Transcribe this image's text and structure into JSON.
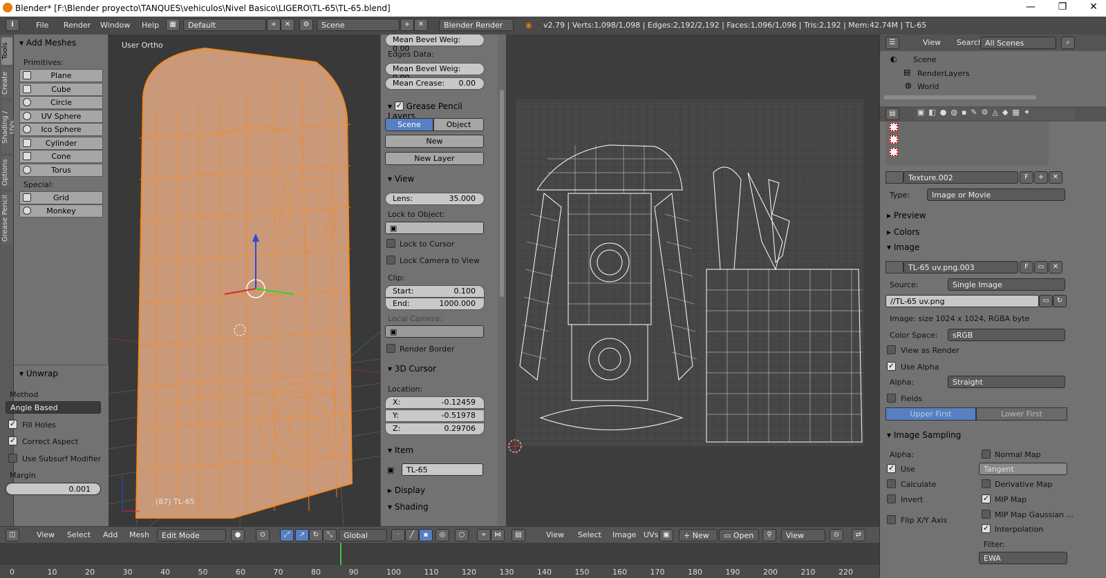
{
  "window": {
    "title": "Blender* [F:\\Blender proyecto\\TANQUES\\vehiculos\\Nivel Basico\\LIGERO\\TL-65\\TL-65.blend]",
    "controls": [
      "—",
      "❐",
      "✕"
    ]
  },
  "infobar": {
    "menus": [
      "File",
      "Render",
      "Window",
      "Help"
    ],
    "layout": "Default",
    "scene": "Scene",
    "engine": "Blender Render",
    "stats": "v2.79 | Verts:1,098/1,098 | Edges:2,192/2,192 | Faces:1,096/1,096 | Tris:2,192 | Mem:42.74M | TL-65"
  },
  "tooltabs": [
    "Tools",
    "Create",
    "Shading / UVs",
    "Options",
    "Grease Pencil"
  ],
  "toolshelf": {
    "panel_title": "Add Meshes",
    "primitives_label": "Primitives:",
    "primitives": [
      "Plane",
      "Cube",
      "Circle",
      "UV Sphere",
      "Ico Sphere",
      "Cylinder",
      "Cone",
      "Torus"
    ],
    "special_label": "Special:",
    "special": [
      "Grid",
      "Monkey"
    ],
    "unwrap": {
      "title": "Unwrap",
      "method_label": "Method",
      "method_value": "Angle Based",
      "fill_holes": "Fill Holes",
      "correct_aspect": "Correct Aspect",
      "use_subsurf": "Use Subsurf Modifier",
      "margin_label": "Margin",
      "margin_value": "0.001"
    }
  },
  "viewport": {
    "view_label": "User Ortho",
    "object_label": "(87) TL-65"
  },
  "props3d": {
    "mean_bevel_vert": "Mean Bevel Weig: 0.00",
    "edges_data": "Edges Data:",
    "mean_bevel_edge": "Mean Bevel Weig: 0.00",
    "mean_crease_label": "Mean Crease:",
    "mean_crease_value": "0.00",
    "grease_pencil": "Grease Pencil Layers",
    "gp_scene": "Scene",
    "gp_object": "Object",
    "gp_new": "New",
    "gp_new_layer": "New Layer",
    "view": "View",
    "lens_label": "Lens:",
    "lens_value": "35.000",
    "lock_to_object": "Lock to Object:",
    "lock_to_cursor": "Lock to Cursor",
    "lock_camera": "Lock Camera to View",
    "clip": "Clip:",
    "start_label": "Start:",
    "start_value": "0.100",
    "end_label": "End:",
    "end_value": "1000.000",
    "local_camera": "Local Camera:",
    "render_border": "Render Border",
    "cursor3d": "3D Cursor",
    "location": "Location:",
    "x_label": "X:",
    "x_value": "-0.12459",
    "y_label": "Y:",
    "y_value": "-0.51978",
    "z_label": "Z:",
    "z_value": "0.29706",
    "item": "Item",
    "item_name": "TL-65",
    "display": "Display",
    "shading": "Shading"
  },
  "header3d": {
    "menus": [
      "View",
      "Select",
      "Add",
      "Mesh"
    ],
    "mode": "Edit Mode",
    "orientation": "Global"
  },
  "header_uv": {
    "menus": [
      "View",
      "Select",
      "Image",
      "UVs"
    ],
    "new": "New",
    "open": "Open",
    "view": "View"
  },
  "outliner": {
    "menus": [
      "View",
      "Search"
    ],
    "filter": "All Scenes",
    "items": [
      "Scene",
      "RenderLayers",
      "World"
    ]
  },
  "texture": {
    "name": "Texture.002",
    "f": "F",
    "type_label": "Type:",
    "type_value": "Image or Movie",
    "preview": "Preview",
    "colors": "Colors",
    "image": "Image",
    "image_name": "TL-65 uv.png.003",
    "source_label": "Source:",
    "source_value": "Single Image",
    "path": "//TL-65 uv.png",
    "info": "Image: size 1024 x 1024, RGBA byte",
    "color_space_label": "Color Space:",
    "color_space_value": "sRGB",
    "view_as_render": "View as Render",
    "use_alpha": "Use Alpha",
    "alpha_label": "Alpha:",
    "alpha_value": "Straight",
    "fields": "Fields",
    "upper_first": "Upper First",
    "lower_first": "Lower First",
    "image_sampling": "Image Sampling",
    "is_alpha": "Alpha:",
    "use": "Use",
    "calculate": "Calculate",
    "invert": "Invert",
    "flip_xy": "Flip X/Y Axis",
    "normal_map": "Normal Map",
    "tangent": "Tangent",
    "derivative_map": "Derivative Map",
    "mip_map": "MIP Map",
    "mip_map_gaussian": "MIP Map Gaussian ...",
    "interpolation": "Interpolation",
    "filter_label": "Filter:",
    "filter_value": "EWA"
  },
  "timeline": {
    "ticks": [
      "0",
      "10",
      "20",
      "30",
      "40",
      "50",
      "60",
      "70",
      "80",
      "90",
      "100",
      "110",
      "120",
      "130",
      "140",
      "150",
      "160",
      "170",
      "180",
      "190",
      "200",
      "210",
      "220"
    ],
    "current_frame": 87
  },
  "colors": {
    "mesh_orange": "#f58a1f",
    "mesh_fill": "#c9997a",
    "accent_blue": "#5680c2"
  }
}
